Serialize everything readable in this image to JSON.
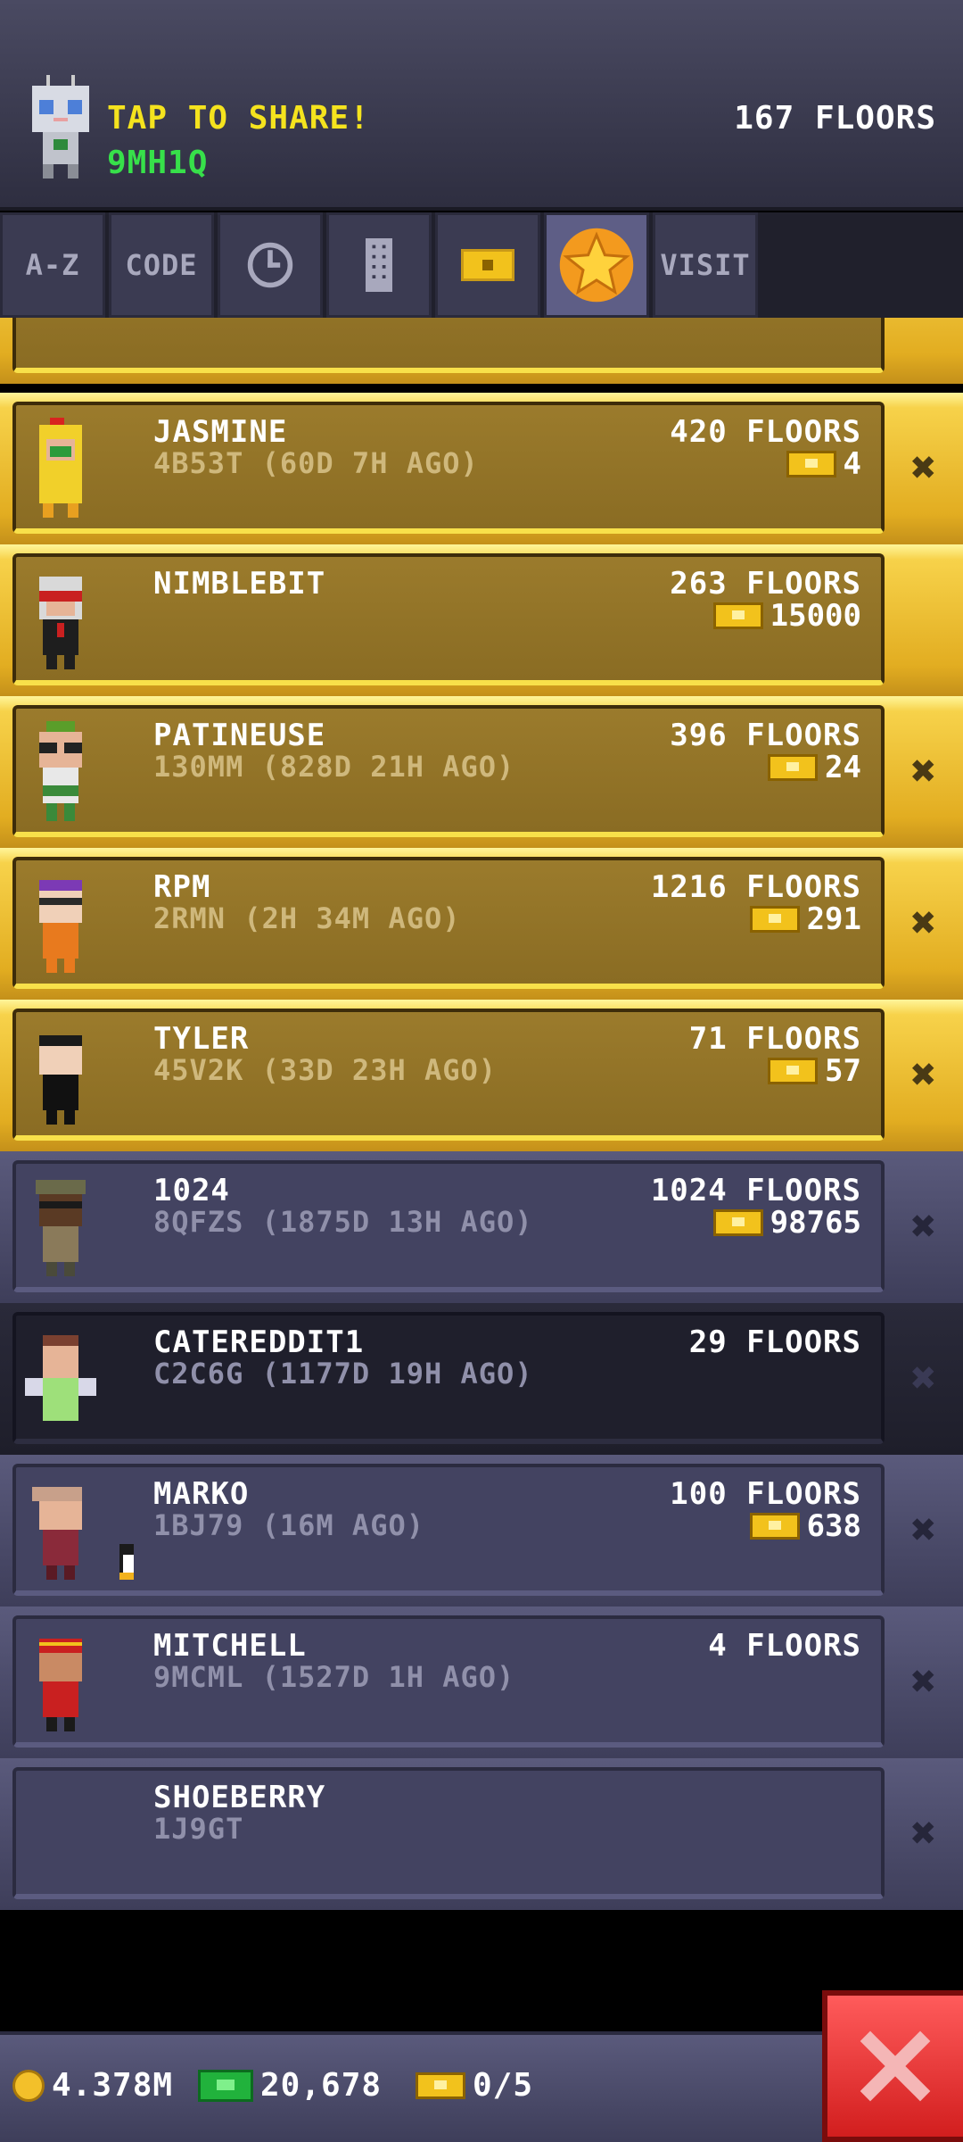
{
  "header": {
    "share_label": "TAP TO SHARE!",
    "share_code": "9MH1Q",
    "floors": "167 FLOORS"
  },
  "tabs": [
    {
      "label": "A-Z",
      "icon": ""
    },
    {
      "label": "CODE",
      "icon": ""
    },
    {
      "label": "",
      "icon": "clock-icon"
    },
    {
      "label": "",
      "icon": "building-icon"
    },
    {
      "label": "",
      "icon": "bux-icon"
    },
    {
      "label": "",
      "icon": "star-icon",
      "active": true
    },
    {
      "label": "VISIT",
      "icon": ""
    }
  ],
  "friends": [
    {
      "name": "JASMINE",
      "sub": "4B53T (60D 7H AGO)",
      "floors": "420 FLOORS",
      "bux": "4",
      "favorite": true
    },
    {
      "name": "NIMBLEBIT",
      "sub": "",
      "floors": "263 FLOORS",
      "bux": "15000",
      "favorite": true
    },
    {
      "name": "PATINEUSE",
      "sub": "130MM (828D 21H AGO)",
      "floors": "396 FLOORS",
      "bux": "24",
      "favorite": true
    },
    {
      "name": "RPM",
      "sub": "2RMN (2H 34M AGO)",
      "floors": "1216 FLOORS",
      "bux": "291",
      "favorite": true
    },
    {
      "name": "TYLER",
      "sub": "45V2K (33D 23H AGO)",
      "floors": "71 FLOORS",
      "bux": "57",
      "favorite": true
    },
    {
      "name": "1024",
      "sub": "8QFZS (1875D 13H AGO)",
      "floors": "1024 FLOORS",
      "bux": "98765",
      "favorite": false
    },
    {
      "name": "CATEREDDIT1",
      "sub": "C2C6G (1177D 19H AGO)",
      "floors": "29 FLOORS",
      "bux": "",
      "favorite": false
    },
    {
      "name": "MARKO",
      "sub": "1BJ79 (16M AGO)",
      "floors": "100 FLOORS",
      "bux": "638",
      "favorite": false
    },
    {
      "name": "MITCHELL",
      "sub": "9MCML (1527D 1H AGO)",
      "floors": "4 FLOORS",
      "bux": "",
      "favorite": false
    },
    {
      "name": "SHOEBERRY",
      "sub": "1J9GT",
      "floors": "",
      "bux": "",
      "favorite": false
    }
  ],
  "bottom": {
    "coins": "4.378M",
    "cash": "20,678",
    "bux_ratio": "0/5"
  },
  "colors": {
    "accent_gold": "#e2ad21",
    "close_red": "#d21e1e"
  }
}
